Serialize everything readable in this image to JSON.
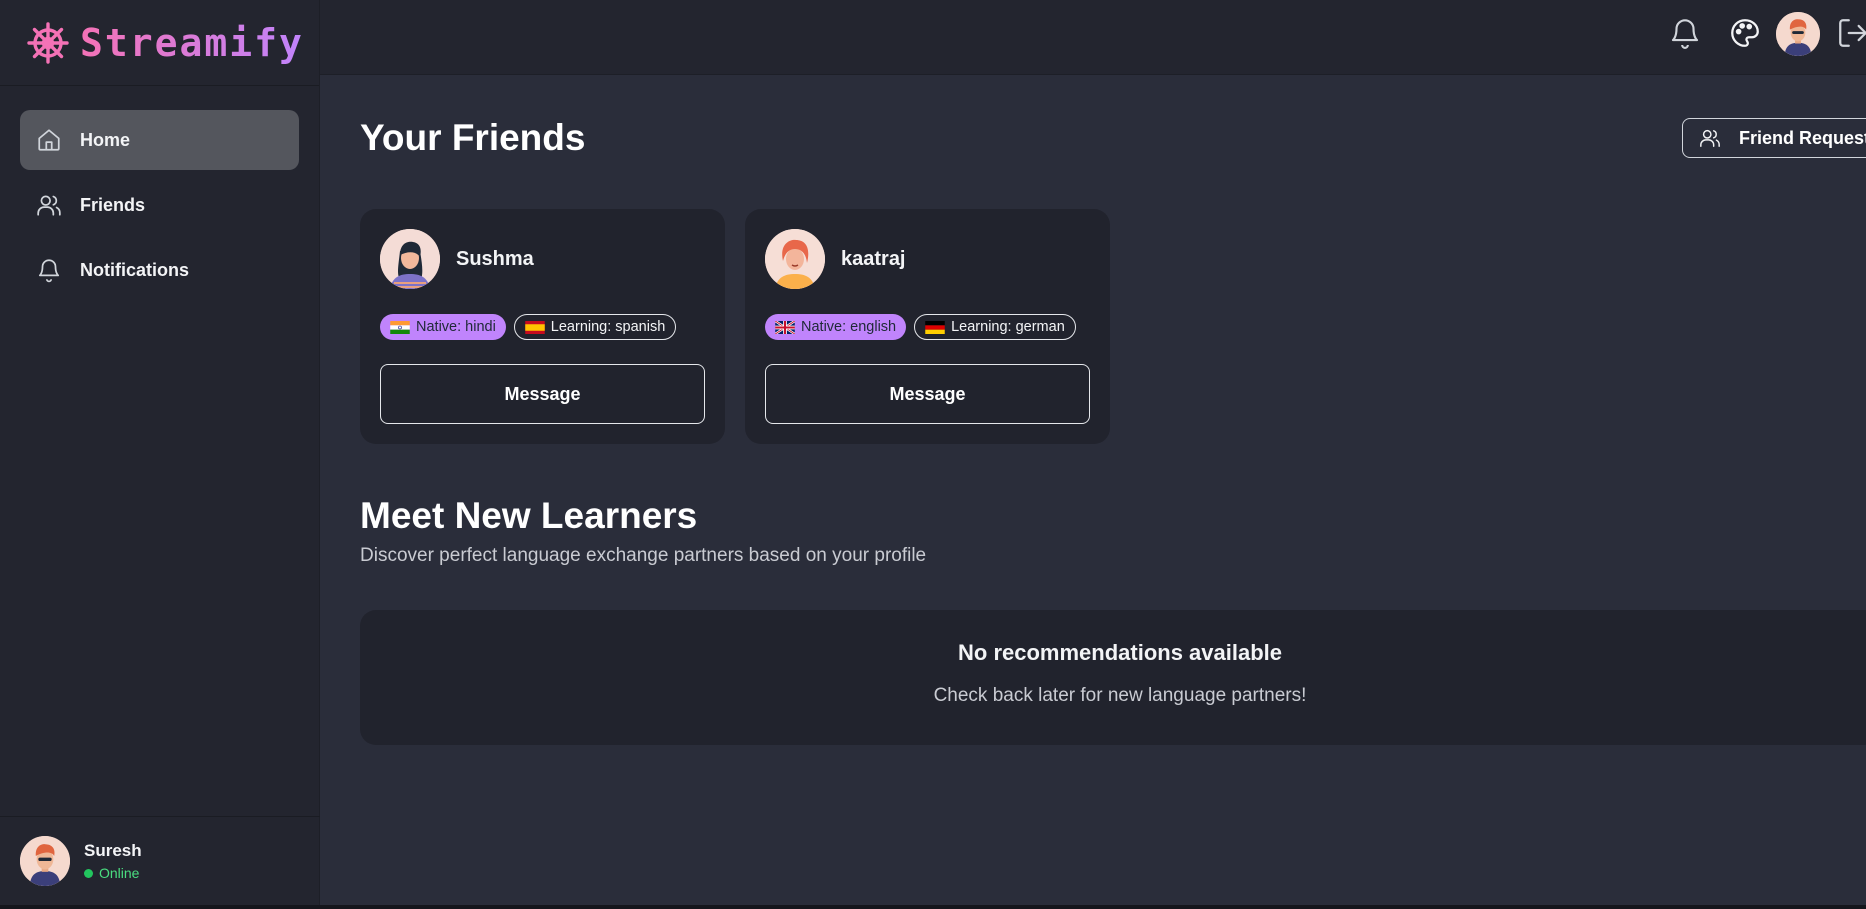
{
  "brand": {
    "name": "Streamify",
    "icon": "ship-wheel-icon",
    "gradient": [
      "#f472b6",
      "#c084fc"
    ]
  },
  "sidebar": {
    "items": [
      {
        "label": "Home",
        "icon": "home-icon",
        "active": true
      },
      {
        "label": "Friends",
        "icon": "users-icon",
        "active": false
      },
      {
        "label": "Notifications",
        "icon": "bell-icon",
        "active": false
      }
    ],
    "user": {
      "name": "Suresh",
      "status": "Online"
    }
  },
  "topbar": {
    "icons": [
      "bell-icon",
      "palette-icon",
      "avatar",
      "logout-icon"
    ]
  },
  "main": {
    "friends_title": "Your Friends",
    "friend_requests_label": "Friend Requests",
    "friends": [
      {
        "name": "Sushma",
        "native": "Native: hindi",
        "learning": "Learning: spanish",
        "native_flag": "flag-india-icon",
        "learning_flag": "flag-spain-icon",
        "message_label": "Message"
      },
      {
        "name": "kaatraj",
        "native": "Native: english",
        "learning": "Learning: german",
        "native_flag": "flag-uk-icon",
        "learning_flag": "flag-germany-icon",
        "message_label": "Message"
      }
    ],
    "meet_title": "Meet New Learners",
    "meet_subtitle": "Discover perfect language exchange partners based on your profile",
    "empty_title": "No recommendations available",
    "empty_subtitle": "Check back later for new language partners!"
  },
  "colors": {
    "accent": "#c084fc",
    "online": "#22c55e",
    "background": "#2a2d3a",
    "card": "#21232d",
    "sidebar": "#23252f"
  }
}
